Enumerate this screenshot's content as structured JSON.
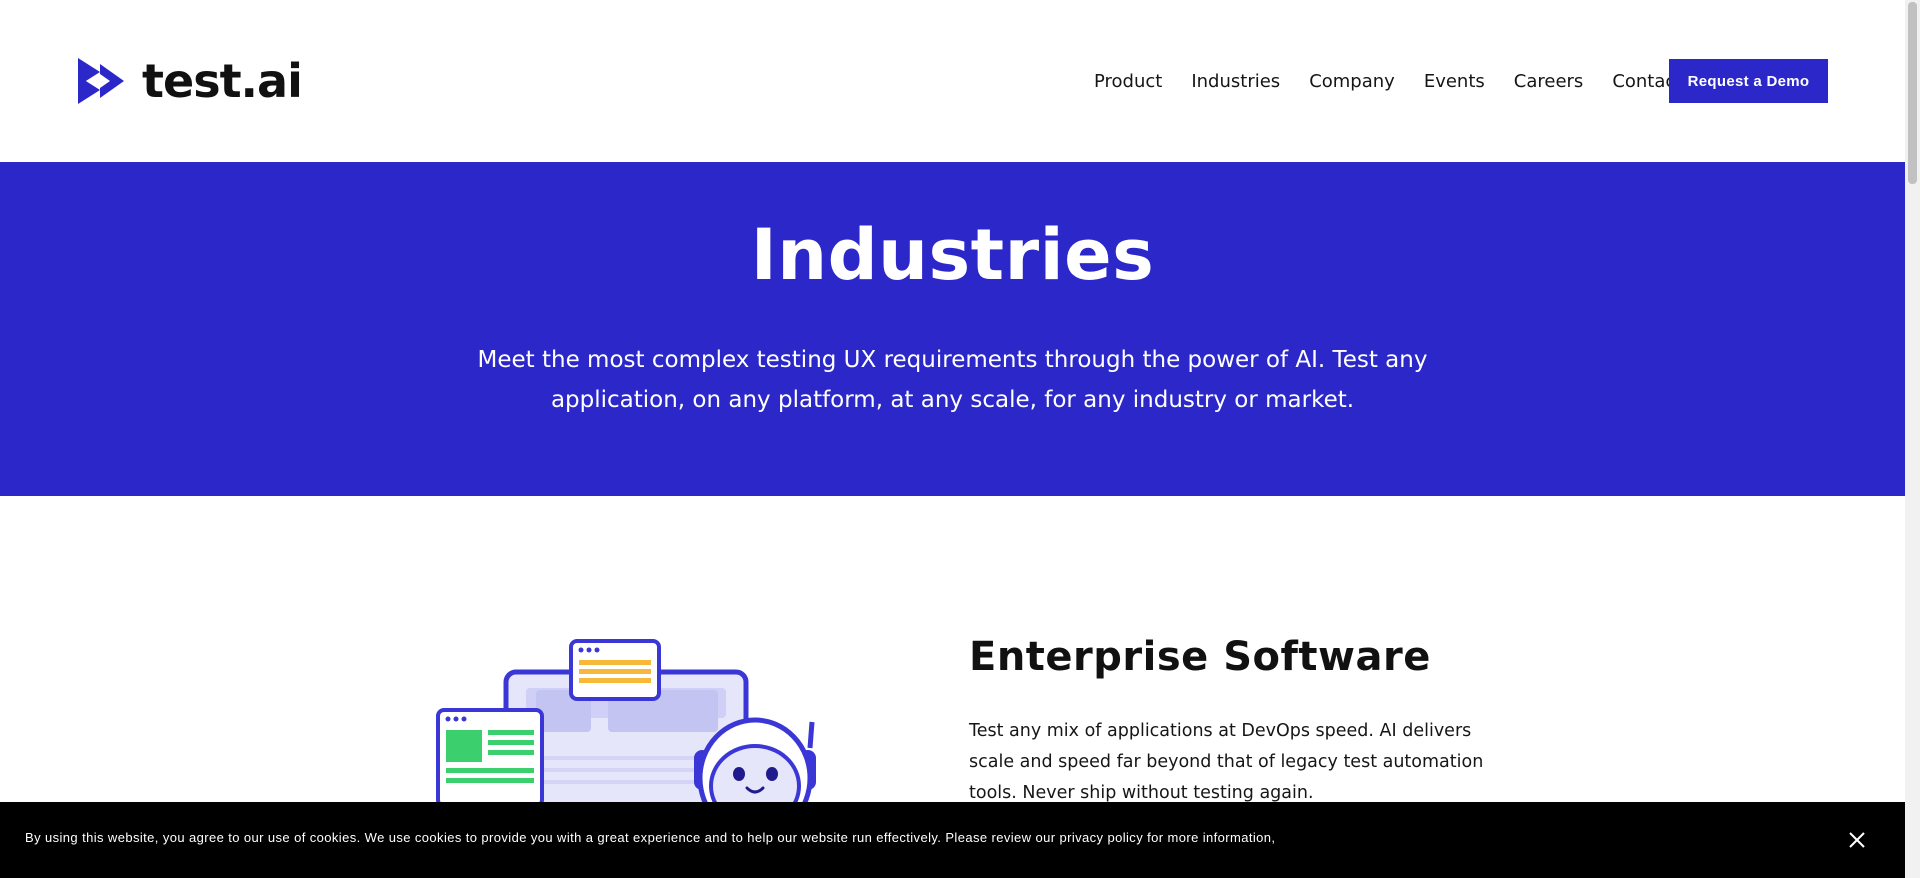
{
  "header": {
    "logo_text": "test.ai",
    "nav": [
      "Product",
      "Industries",
      "Company",
      "Events",
      "Careers",
      "Contact"
    ],
    "cta_label": "Request a Demo"
  },
  "hero": {
    "title": "Industries",
    "subtitle": "Meet the most complex testing UX requirements through the power of AI. Test any application, on any platform, at any scale, for any industry or market."
  },
  "section": {
    "title": "Enterprise Software",
    "body": "Test any mix of applications at DevOps speed. AI delivers scale and speed far beyond that of legacy test automation tools. Never ship without testing again.",
    "illustration_icon": "robot-laptop-illustration"
  },
  "cookie_banner": {
    "text": "By using this website, you agree to our use of cookies. We use cookies to provide you with a great experience and to help our website run effectively. Please review our privacy policy for more information,",
    "close_icon": "close-icon"
  },
  "colors": {
    "brand_blue": "#2b27c9",
    "banner_bg": "#000000",
    "text": "#161616"
  }
}
